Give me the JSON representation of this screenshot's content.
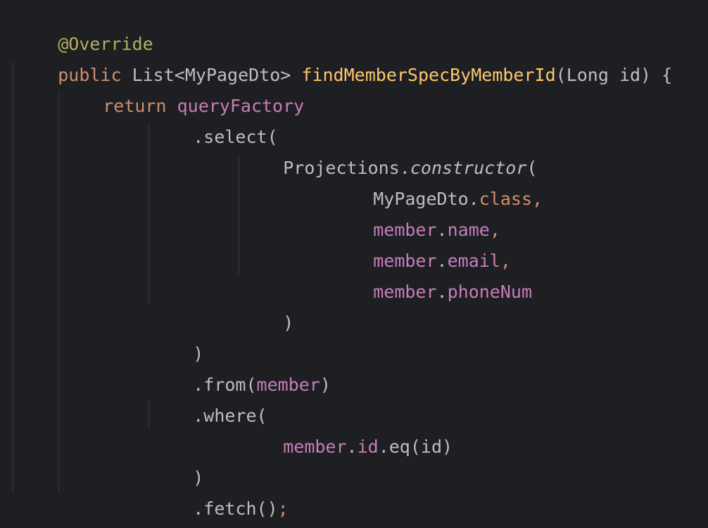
{
  "colors": {
    "background": "#1e1f22",
    "default": "#bcbec4",
    "annotation": "#b3ae60",
    "keyword": "#cf8e6d",
    "method_declaration": "#ffc66d",
    "field": "#c77dbb",
    "indent_guide": "#393b40"
  },
  "code": {
    "l1_annotation": "@Override",
    "l2_public": "public",
    "l2_return_type": " List<MyPageDto> ",
    "l2_method": "findMemberSpecByMemberId",
    "l2_params": "(Long id) {",
    "l3_return": "return",
    "l3_space": " ",
    "l3_queryFactory": "queryFactory",
    "l4_select": ".select(",
    "l5_projections": "Projections.",
    "l5_constructor": "constructor",
    "l5_paren": "(",
    "l6_mypagedto": "MyPageDto.",
    "l6_class": "class,",
    "l7_member": "member",
    "l7_dot": ".",
    "l7_name": "name",
    "l7_comma": ",",
    "l8_member": "member",
    "l8_dot": ".",
    "l8_email": "email",
    "l8_comma": ",",
    "l9_member": "member",
    "l9_dot": ".",
    "l9_phoneNum": "phoneNum",
    "l10_close": ")",
    "l11_close": ")",
    "l12_from": ".from(",
    "l12_member": "member",
    "l12_close": ")",
    "l13_where": ".where(",
    "l14_member": "member",
    "l14_dot": ".",
    "l14_id": "id",
    "l14_eq": ".eq(id)",
    "l15_close": ")",
    "l16_fetch": ".fetch()",
    "l16_semicolon": ";",
    "l17_brace": "}"
  }
}
